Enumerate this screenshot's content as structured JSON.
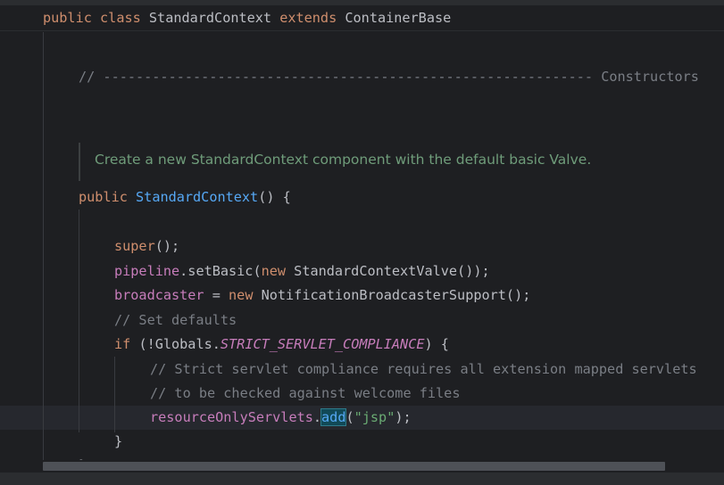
{
  "code": {
    "class_decl": {
      "kw1": "public",
      "kw2": "class",
      "name": "StandardContext",
      "kw3": "extends",
      "base": "ContainerBase"
    },
    "separator_comment": "// ------------------------------------------------------------ Constructors",
    "doc_comment": "Create a new StandardContext component with the default basic Valve.",
    "ctor": {
      "kw": "public",
      "name": "StandardContext",
      "rest": "() {"
    },
    "line_super": {
      "kw": "super",
      "rest": "();"
    },
    "line_pipeline": {
      "field": "pipeline",
      "call": ".setBasic(",
      "kw": "new",
      "rest": " StandardContextValve());"
    },
    "line_broadcaster": {
      "field": "broadcaster",
      "op": " = ",
      "kw": "new",
      "rest": " NotificationBroadcasterSupport();"
    },
    "comment_defaults": "// Set defaults",
    "if_line": {
      "kw": "if",
      "open": " (!Globals.",
      "const": "STRICT_SERVLET_COMPLIANCE",
      "close": ") {"
    },
    "comment_strict1": "// Strict servlet compliance requires all extension mapped servlets",
    "comment_strict2": "// to be checked against welcome files",
    "resource_line": {
      "field": "resourceOnlyServlets",
      "dot": ".",
      "method": "add",
      "open": "(",
      "str": "\"jsp\"",
      "close": ");"
    },
    "close_if": "}",
    "close_ctor": "}"
  },
  "colors": {
    "background": "#1e1f22",
    "keyword": "#cf8e6d",
    "function": "#56a8f5",
    "field": "#c77dbb",
    "string": "#6aab73",
    "comment": "#7a7e85",
    "doc": "#6f9c7a",
    "text": "#bcbec4"
  }
}
